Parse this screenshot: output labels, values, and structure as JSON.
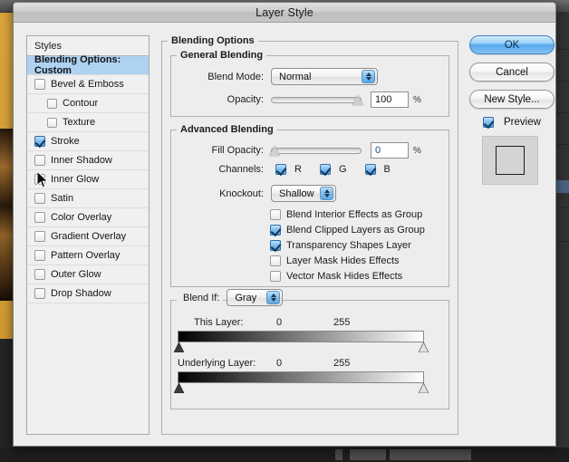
{
  "window": {
    "title": "Layer Style"
  },
  "styles_panel": {
    "header": "Styles",
    "items": [
      {
        "label": "Blending Options: Custom",
        "checkbox": false,
        "selected": true,
        "indent": false
      },
      {
        "label": "Bevel & Emboss",
        "checkbox": true,
        "checked": false,
        "selected": false,
        "indent": false
      },
      {
        "label": "Contour",
        "checkbox": true,
        "checked": false,
        "selected": false,
        "indent": true
      },
      {
        "label": "Texture",
        "checkbox": true,
        "checked": false,
        "selected": false,
        "indent": true
      },
      {
        "label": "Stroke",
        "checkbox": true,
        "checked": true,
        "selected": false,
        "indent": false
      },
      {
        "label": "Inner Shadow",
        "checkbox": true,
        "checked": false,
        "selected": false,
        "indent": false
      },
      {
        "label": "Inner Glow",
        "checkbox": true,
        "checked": false,
        "selected": false,
        "indent": false
      },
      {
        "label": "Satin",
        "checkbox": true,
        "checked": false,
        "selected": false,
        "indent": false
      },
      {
        "label": "Color Overlay",
        "checkbox": true,
        "checked": false,
        "selected": false,
        "indent": false
      },
      {
        "label": "Gradient Overlay",
        "checkbox": true,
        "checked": false,
        "selected": false,
        "indent": false
      },
      {
        "label": "Pattern Overlay",
        "checkbox": true,
        "checked": false,
        "selected": false,
        "indent": false
      },
      {
        "label": "Outer Glow",
        "checkbox": true,
        "checked": false,
        "selected": false,
        "indent": false
      },
      {
        "label": "Drop Shadow",
        "checkbox": true,
        "checked": false,
        "selected": false,
        "indent": false
      }
    ]
  },
  "blending_options": {
    "legend": "Blending Options",
    "general": {
      "legend": "General Blending",
      "blend_mode_label": "Blend Mode:",
      "blend_mode_value": "Normal",
      "opacity_label": "Opacity:",
      "opacity_value": "100",
      "opacity_unit": "%"
    },
    "advanced": {
      "legend": "Advanced Blending",
      "fill_opacity_label": "Fill Opacity:",
      "fill_opacity_value": "0",
      "fill_opacity_unit": "%",
      "channels_label": "Channels:",
      "channels": [
        {
          "label": "R",
          "checked": true
        },
        {
          "label": "G",
          "checked": true
        },
        {
          "label": "B",
          "checked": true
        }
      ],
      "knockout_label": "Knockout:",
      "knockout_value": "Shallow",
      "options": [
        {
          "label": "Blend Interior Effects as Group",
          "checked": false
        },
        {
          "label": "Blend Clipped Layers as Group",
          "checked": true
        },
        {
          "label": "Transparency Shapes Layer",
          "checked": true
        },
        {
          "label": "Layer Mask Hides Effects",
          "checked": false
        },
        {
          "label": "Vector Mask Hides Effects",
          "checked": false
        }
      ]
    },
    "blend_if": {
      "legend_label": "Blend If:",
      "channel_value": "Gray",
      "this_layer": {
        "label": "This Layer:",
        "min": "0",
        "max": "255"
      },
      "underlying_layer": {
        "label": "Underlying Layer:",
        "min": "0",
        "max": "255"
      }
    }
  },
  "buttons": {
    "ok": "OK",
    "cancel": "Cancel",
    "new_style": "New Style...",
    "preview_label": "Preview",
    "preview_checked": true
  },
  "colors": {
    "accent_blue": "#aed2f2",
    "default_button": "#56a8ec",
    "dialog_bg": "#ededed",
    "canvas_orange": "#d9a53c"
  }
}
